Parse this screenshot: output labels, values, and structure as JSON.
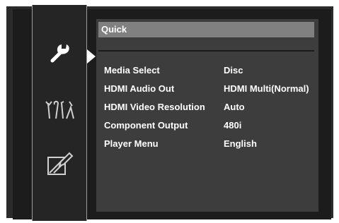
{
  "sidebar": {
    "items": [
      {
        "icon": "wrench-icon",
        "active": true
      },
      {
        "icon": "tools-icon",
        "active": false
      },
      {
        "icon": "edit-icon",
        "active": false
      }
    ]
  },
  "panel": {
    "title": "Quick",
    "rows": [
      {
        "label": "Media Select",
        "value": "Disc"
      },
      {
        "label": "HDMI Audio Out",
        "value": "HDMI Multi(Normal)"
      },
      {
        "label": "HDMI Video Resolution",
        "value": "Auto"
      },
      {
        "label": "Component Output",
        "value": "480i"
      },
      {
        "label": "Player Menu",
        "value": "English"
      }
    ]
  },
  "colors": {
    "background": "#1c1c1c",
    "panel": "#3d3d3d",
    "title_bar": "#808080",
    "text": "#ffffff"
  }
}
